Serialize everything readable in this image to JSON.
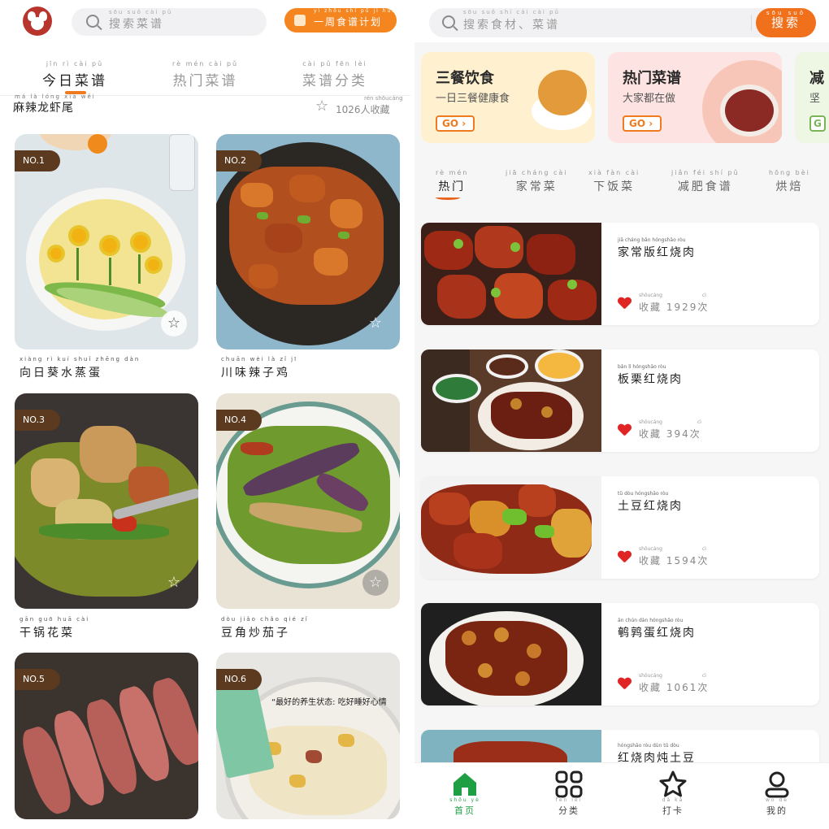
{
  "left": {
    "search": {
      "placeholder": "搜索菜谱",
      "placeholder_pinyin": "sōu suǒ cài pǔ"
    },
    "plan_button": {
      "label": "一周食谱计划",
      "pinyin": "yì zhōu shí pǔ jì huà"
    },
    "tabs": [
      {
        "label": "今日菜谱",
        "pinyin": "jīn rì cài pǔ",
        "active": true
      },
      {
        "label": "热门菜谱",
        "pinyin": "rè mén cài pǔ",
        "active": false
      },
      {
        "label": "菜谱分类",
        "pinyin": "cài pǔ fēn lèi",
        "active": false
      }
    ],
    "previous": {
      "title": "麻辣龙虾尾",
      "pinyin": "má là lóng xiā wěi",
      "count": "1026人收藏",
      "count_pinyin": "rén shōucáng"
    },
    "dishes": [
      {
        "badge": "NO.1",
        "name": "向日葵水蒸蛋",
        "pinyin": "xiàng rì kuí shuǐ zhēng dàn"
      },
      {
        "badge": "NO.2",
        "name": "川味辣子鸡",
        "pinyin": "chuān wèi là zǐ jī"
      },
      {
        "badge": "NO.3",
        "name": "干锅花菜",
        "pinyin": "gān guō huā cài"
      },
      {
        "badge": "NO.4",
        "name": "豆角炒茄子",
        "pinyin": "dòu jiǎo chǎo qié zǐ"
      },
      {
        "badge": "NO.5",
        "name": "",
        "pinyin": ""
      },
      {
        "badge": "NO.6",
        "name": "",
        "pinyin": "",
        "image_caption": "“最好的养生状态: 吃好睡好心情"
      }
    ],
    "colors": {
      "accent": "#f5851f",
      "badge": "#5b3a1f"
    }
  },
  "right": {
    "search": {
      "placeholder": "搜索食材、菜谱",
      "placeholder_pinyin": "sōu suǒ shí cái  cài pǔ",
      "button": "搜索",
      "button_pinyin": "sōu suǒ"
    },
    "promos": [
      {
        "title": "三餐饮食",
        "subtitle": "一日三餐健康食",
        "go": "GO",
        "bg": "#fff3d4"
      },
      {
        "title": "热门菜谱",
        "subtitle": "大家都在做",
        "go": "GO",
        "bg": "#fde5e5"
      },
      {
        "title": "减",
        "subtitle": "坚",
        "go": "G",
        "bg": "#eef7e6"
      }
    ],
    "tabs": [
      {
        "label": "热门",
        "pinyin": "rè mén",
        "active": true
      },
      {
        "label": "家常菜",
        "pinyin": "jiā cháng cài",
        "active": false
      },
      {
        "label": "下饭菜",
        "pinyin": "xià fàn cài",
        "active": false
      },
      {
        "label": "减肥食谱",
        "pinyin": "jiǎn féi shí pǔ",
        "active": false
      },
      {
        "label": "烘焙",
        "pinyin": "hōng bèi",
        "active": false
      }
    ],
    "recipes": [
      {
        "title": "家常版红烧肉",
        "pinyin": "jiā cháng bǎn hóngshāo ròu",
        "fav_label": "收藏",
        "fav_pinyin": "shōucáng",
        "count": "1929",
        "count_unit": "次",
        "unit_pinyin": "cì"
      },
      {
        "title": "板栗红烧肉",
        "pinyin": "bǎn lì hóngshāo ròu",
        "fav_label": "收藏",
        "fav_pinyin": "shōucáng",
        "count": "394",
        "count_unit": "次",
        "unit_pinyin": "cì"
      },
      {
        "title": "土豆红烧肉",
        "pinyin": "tǔ dòu hóngshāo ròu",
        "fav_label": "收藏",
        "fav_pinyin": "shōucáng",
        "count": "1594",
        "count_unit": "次",
        "unit_pinyin": "cì"
      },
      {
        "title": "鹌鹑蛋红烧肉",
        "pinyin": "ān chún dàn hóngshāo ròu",
        "fav_label": "收藏",
        "fav_pinyin": "shōucáng",
        "count": "1061",
        "count_unit": "次",
        "unit_pinyin": "cì"
      },
      {
        "title": "红烧肉炖土豆",
        "pinyin": "hóngshāo ròu dùn tǔ dòu"
      }
    ],
    "nav": [
      {
        "label": "首页",
        "pinyin": "shǒu yè",
        "icon": "home-icon",
        "active": true
      },
      {
        "label": "分类",
        "pinyin": "fēn lèi",
        "icon": "grid-icon",
        "active": false
      },
      {
        "label": "打卡",
        "pinyin": "dǎ kǎ",
        "icon": "star-icon",
        "active": false
      },
      {
        "label": "我的",
        "pinyin": "wǒ de",
        "icon": "profile-icon",
        "active": false
      }
    ],
    "colors": {
      "accent": "#f0701b",
      "nav_active": "#1f9f44",
      "heart": "#e02525"
    }
  }
}
